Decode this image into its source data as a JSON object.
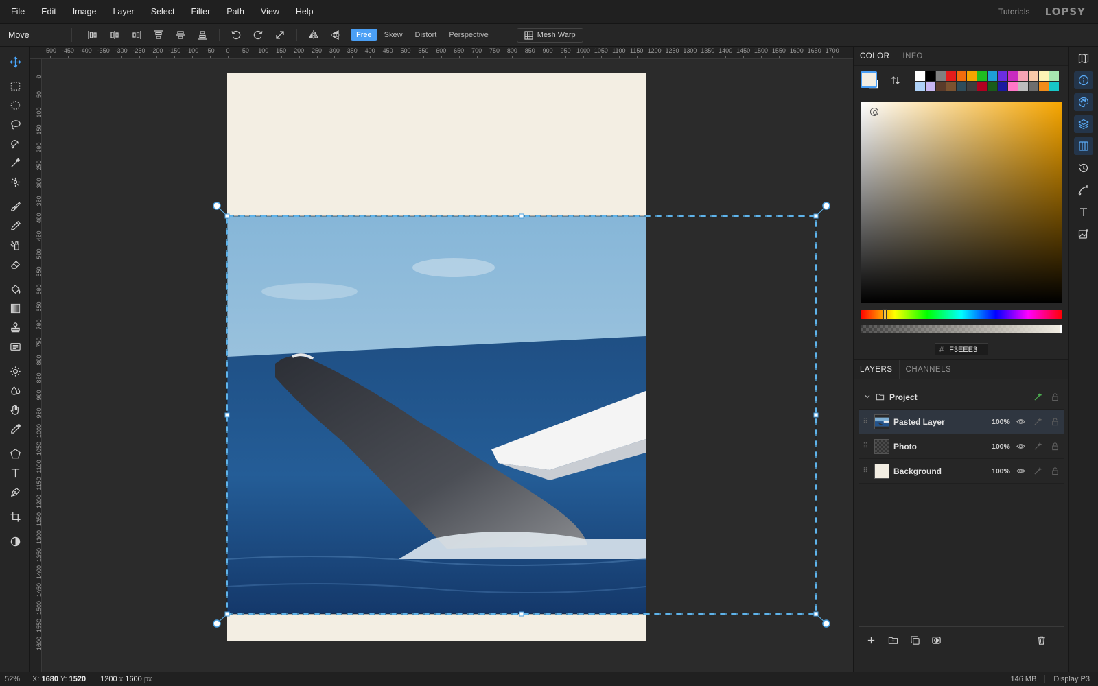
{
  "menu": {
    "items": [
      "File",
      "Edit",
      "Image",
      "Layer",
      "Select",
      "Filter",
      "Path",
      "View",
      "Help"
    ],
    "tutorials": "Tutorials",
    "logo": "LOPSY"
  },
  "options": {
    "tool_name": "Move",
    "align_icons": [
      "align-left-icon",
      "align-center-h-icon",
      "align-right-icon",
      "align-top-icon",
      "align-middle-v-icon",
      "align-bottom-icon"
    ],
    "transform_icons": [
      "rotate-ccw-icon",
      "rotate-cw-icon",
      "resize-icon",
      "flip-horizontal-icon",
      "flip-vertical-icon"
    ],
    "modes": [
      "Free",
      "Skew",
      "Distort",
      "Perspective"
    ],
    "active_mode": "Free",
    "mesh_warp": "Mesh Warp",
    "accent": "#4a9ff5"
  },
  "rulers": {
    "top_labels": [
      "-500",
      "-450",
      "-400",
      "-350",
      "-300",
      "-250",
      "-200",
      "-150",
      "-100",
      "-50",
      "0",
      "50",
      "100",
      "150",
      "200",
      "250",
      "300",
      "350",
      "400",
      "450",
      "500",
      "550",
      "600",
      "650",
      "700",
      "750",
      "800",
      "850",
      "900",
      "950",
      "1000",
      "1050",
      "1100",
      "1150",
      "1200",
      "1250",
      "1300",
      "1350",
      "1400",
      "1450",
      "1500",
      "1550",
      "1600",
      "1650",
      "1700"
    ],
    "left_labels": [
      "0",
      "50",
      "100",
      "150",
      "200",
      "250",
      "300",
      "350",
      "400",
      "450",
      "500",
      "550",
      "600",
      "650",
      "700",
      "750",
      "800",
      "850",
      "900",
      "950",
      "1000",
      "1050",
      "1100",
      "1150",
      "1200",
      "1250",
      "1300",
      "1350",
      "1400",
      "1450",
      "1500",
      "1550",
      "1600"
    ]
  },
  "color_panel": {
    "tabs": [
      "COLOR",
      "INFO"
    ],
    "active_tab": "COLOR",
    "foreground": "#F3EEE3",
    "background": "#FFFFFF",
    "hex_value": "F3EEE3",
    "palette": [
      "#ffffff",
      "#000000",
      "#808080",
      "#e51c1c",
      "#f26c0d",
      "#f5a500",
      "#1fbe1f",
      "#1e9fd6",
      "#6b2de0",
      "#c92bc0",
      "#f6a3b4",
      "#f8c9a8",
      "#fdf3b5",
      "#a8e8b1",
      "#aed1f7",
      "#c8b7f2",
      "#5a3b2a",
      "#7a5230",
      "#2e4c5a",
      "#3d3d3d",
      "#b00020",
      "#1a5c1a",
      "#1a1aa0",
      "#ff77c8",
      "#bdbdbd",
      "#6e6e6e",
      "#f08c1a",
      "#17c7c7"
    ]
  },
  "layers_panel": {
    "tabs": [
      "LAYERS",
      "CHANNELS"
    ],
    "active_tab": "LAYERS",
    "group": "Project",
    "layers": [
      {
        "name": "Pasted Layer",
        "opacity": "100%",
        "selected": true
      },
      {
        "name": "Photo",
        "opacity": "100%",
        "selected": false
      },
      {
        "name": "Background",
        "opacity": "100%",
        "selected": false
      }
    ]
  },
  "status": {
    "zoom": "52%",
    "x_label": "X:",
    "x_value": "1680",
    "y_label": "Y:",
    "y_value": "1520",
    "width": "1200",
    "times": "x",
    "height": "1600",
    "unit": "px",
    "memory": "146 MB",
    "profile": "Display P3"
  }
}
